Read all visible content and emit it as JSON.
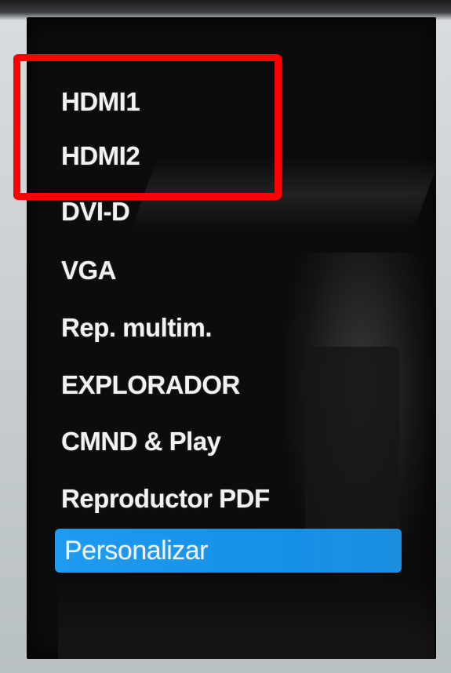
{
  "menu": {
    "items": [
      {
        "label": "HDMI1",
        "selected": false
      },
      {
        "label": "HDMI2",
        "selected": false
      },
      {
        "label": "DVI-D",
        "selected": false
      },
      {
        "label": "VGA",
        "selected": false
      },
      {
        "label": "Rep. multim.",
        "selected": false
      },
      {
        "label": "EXPLORADOR",
        "selected": false
      },
      {
        "label": "CMND & Play",
        "selected": false
      },
      {
        "label": "Reproductor PDF",
        "selected": false
      },
      {
        "label": "Personalizar",
        "selected": true
      }
    ]
  },
  "annotation": {
    "color": "#ff0000"
  },
  "theme": {
    "selected_bg": "#1e9bf0",
    "text_color": "#f2f2f2",
    "screen_bg": "#0c0c0d"
  }
}
